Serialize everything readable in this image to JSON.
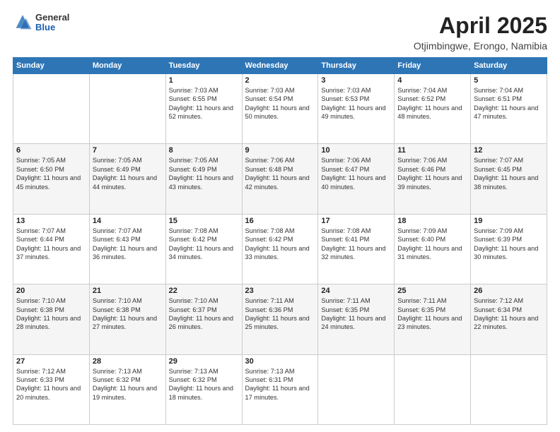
{
  "header": {
    "logo_general": "General",
    "logo_blue": "Blue",
    "month_title": "April 2025",
    "location": "Otjimbingwe, Erongo, Namibia"
  },
  "calendar": {
    "days_of_week": [
      "Sunday",
      "Monday",
      "Tuesday",
      "Wednesday",
      "Thursday",
      "Friday",
      "Saturday"
    ],
    "weeks": [
      [
        {
          "day": "",
          "info": ""
        },
        {
          "day": "",
          "info": ""
        },
        {
          "day": "1",
          "info": "Sunrise: 7:03 AM\nSunset: 6:55 PM\nDaylight: 11 hours and 52 minutes."
        },
        {
          "day": "2",
          "info": "Sunrise: 7:03 AM\nSunset: 6:54 PM\nDaylight: 11 hours and 50 minutes."
        },
        {
          "day": "3",
          "info": "Sunrise: 7:03 AM\nSunset: 6:53 PM\nDaylight: 11 hours and 49 minutes."
        },
        {
          "day": "4",
          "info": "Sunrise: 7:04 AM\nSunset: 6:52 PM\nDaylight: 11 hours and 48 minutes."
        },
        {
          "day": "5",
          "info": "Sunrise: 7:04 AM\nSunset: 6:51 PM\nDaylight: 11 hours and 47 minutes."
        }
      ],
      [
        {
          "day": "6",
          "info": "Sunrise: 7:05 AM\nSunset: 6:50 PM\nDaylight: 11 hours and 45 minutes."
        },
        {
          "day": "7",
          "info": "Sunrise: 7:05 AM\nSunset: 6:49 PM\nDaylight: 11 hours and 44 minutes."
        },
        {
          "day": "8",
          "info": "Sunrise: 7:05 AM\nSunset: 6:49 PM\nDaylight: 11 hours and 43 minutes."
        },
        {
          "day": "9",
          "info": "Sunrise: 7:06 AM\nSunset: 6:48 PM\nDaylight: 11 hours and 42 minutes."
        },
        {
          "day": "10",
          "info": "Sunrise: 7:06 AM\nSunset: 6:47 PM\nDaylight: 11 hours and 40 minutes."
        },
        {
          "day": "11",
          "info": "Sunrise: 7:06 AM\nSunset: 6:46 PM\nDaylight: 11 hours and 39 minutes."
        },
        {
          "day": "12",
          "info": "Sunrise: 7:07 AM\nSunset: 6:45 PM\nDaylight: 11 hours and 38 minutes."
        }
      ],
      [
        {
          "day": "13",
          "info": "Sunrise: 7:07 AM\nSunset: 6:44 PM\nDaylight: 11 hours and 37 minutes."
        },
        {
          "day": "14",
          "info": "Sunrise: 7:07 AM\nSunset: 6:43 PM\nDaylight: 11 hours and 36 minutes."
        },
        {
          "day": "15",
          "info": "Sunrise: 7:08 AM\nSunset: 6:42 PM\nDaylight: 11 hours and 34 minutes."
        },
        {
          "day": "16",
          "info": "Sunrise: 7:08 AM\nSunset: 6:42 PM\nDaylight: 11 hours and 33 minutes."
        },
        {
          "day": "17",
          "info": "Sunrise: 7:08 AM\nSunset: 6:41 PM\nDaylight: 11 hours and 32 minutes."
        },
        {
          "day": "18",
          "info": "Sunrise: 7:09 AM\nSunset: 6:40 PM\nDaylight: 11 hours and 31 minutes."
        },
        {
          "day": "19",
          "info": "Sunrise: 7:09 AM\nSunset: 6:39 PM\nDaylight: 11 hours and 30 minutes."
        }
      ],
      [
        {
          "day": "20",
          "info": "Sunrise: 7:10 AM\nSunset: 6:38 PM\nDaylight: 11 hours and 28 minutes."
        },
        {
          "day": "21",
          "info": "Sunrise: 7:10 AM\nSunset: 6:38 PM\nDaylight: 11 hours and 27 minutes."
        },
        {
          "day": "22",
          "info": "Sunrise: 7:10 AM\nSunset: 6:37 PM\nDaylight: 11 hours and 26 minutes."
        },
        {
          "day": "23",
          "info": "Sunrise: 7:11 AM\nSunset: 6:36 PM\nDaylight: 11 hours and 25 minutes."
        },
        {
          "day": "24",
          "info": "Sunrise: 7:11 AM\nSunset: 6:35 PM\nDaylight: 11 hours and 24 minutes."
        },
        {
          "day": "25",
          "info": "Sunrise: 7:11 AM\nSunset: 6:35 PM\nDaylight: 11 hours and 23 minutes."
        },
        {
          "day": "26",
          "info": "Sunrise: 7:12 AM\nSunset: 6:34 PM\nDaylight: 11 hours and 22 minutes."
        }
      ],
      [
        {
          "day": "27",
          "info": "Sunrise: 7:12 AM\nSunset: 6:33 PM\nDaylight: 11 hours and 20 minutes."
        },
        {
          "day": "28",
          "info": "Sunrise: 7:13 AM\nSunset: 6:32 PM\nDaylight: 11 hours and 19 minutes."
        },
        {
          "day": "29",
          "info": "Sunrise: 7:13 AM\nSunset: 6:32 PM\nDaylight: 11 hours and 18 minutes."
        },
        {
          "day": "30",
          "info": "Sunrise: 7:13 AM\nSunset: 6:31 PM\nDaylight: 11 hours and 17 minutes."
        },
        {
          "day": "",
          "info": ""
        },
        {
          "day": "",
          "info": ""
        },
        {
          "day": "",
          "info": ""
        }
      ]
    ]
  }
}
